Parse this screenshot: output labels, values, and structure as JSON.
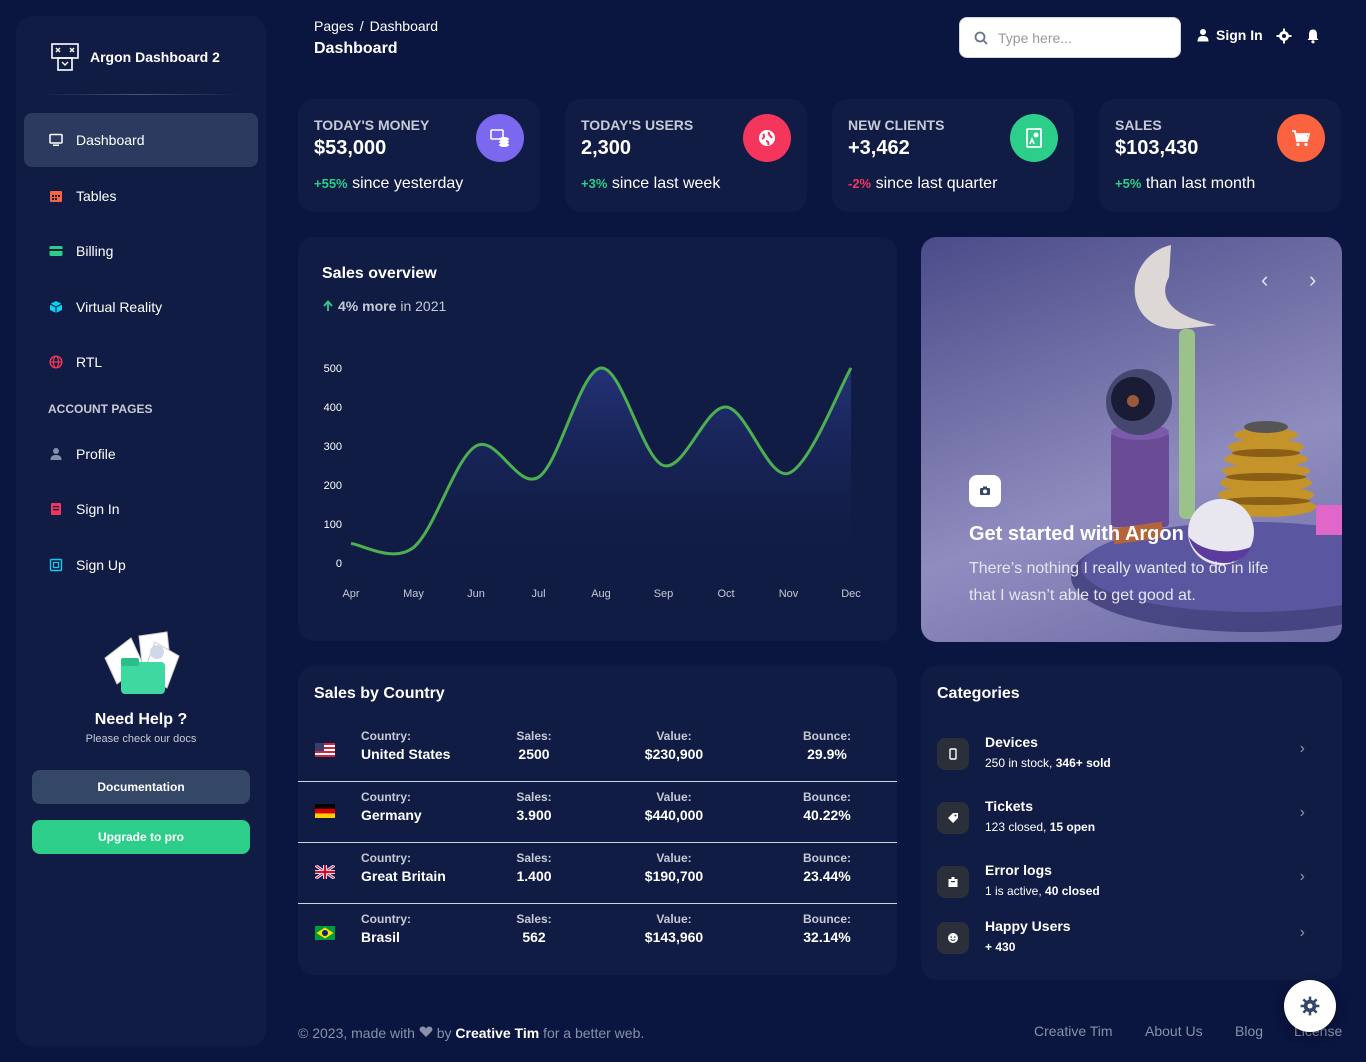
{
  "sidebar": {
    "brand": "Argon Dashboard 2",
    "items": [
      {
        "label": "Dashboard",
        "icon": "tv-icon",
        "color": "#ffffff"
      },
      {
        "label": "Tables",
        "icon": "calendar-icon",
        "color": "#fb6340"
      },
      {
        "label": "Billing",
        "icon": "credit-card-icon",
        "color": "#2dce89"
      },
      {
        "label": "Virtual Reality",
        "icon": "cube-icon",
        "color": "#11cdef"
      },
      {
        "label": "RTL",
        "icon": "world-icon",
        "color": "#f5365c"
      }
    ],
    "section_label": "ACCOUNT PAGES",
    "account_items": [
      {
        "label": "Profile",
        "icon": "user-icon",
        "color": "#8392ab"
      },
      {
        "label": "Sign In",
        "icon": "copy-icon",
        "color": "#f5365c"
      },
      {
        "label": "Sign Up",
        "icon": "collection-icon",
        "color": "#11cdef"
      }
    ],
    "help": {
      "title": "Need Help ?",
      "subtitle": "Please check our docs"
    },
    "doc_button": "Documentation",
    "pro_button": "Upgrade to pro"
  },
  "header": {
    "breadcrumb_root": "Pages",
    "breadcrumb_sep": "/",
    "breadcrumb_current": "Dashboard",
    "title": "Dashboard",
    "search_placeholder": "Type here...",
    "signin": "Sign In"
  },
  "stats": [
    {
      "label": "Today's Money",
      "value": "$53,000",
      "change": "+55%",
      "change_text": " since yesterday",
      "trend": "up",
      "icon": "money-coins-icon",
      "icon_bg": "#7b68ee"
    },
    {
      "label": "Today's Users",
      "value": "2,300",
      "change": "+3%",
      "change_text": " since last week",
      "trend": "up",
      "icon": "world-icon",
      "icon_bg": "#f5365c"
    },
    {
      "label": "New Clients",
      "value": "+3,462",
      "change": "-2%",
      "change_text": " since last quarter",
      "trend": "down",
      "icon": "paper-diploma-icon",
      "icon_bg": "#2dce89"
    },
    {
      "label": "Sales",
      "value": "$103,430",
      "change": "+5%",
      "change_text": " than last month",
      "trend": "up",
      "icon": "cart-icon",
      "icon_bg": "#fb6340"
    }
  ],
  "sales_overview": {
    "title": "Sales overview",
    "highlight": "4% more",
    "suffix": " in 2021"
  },
  "chart_data": {
    "type": "line",
    "categories": [
      "Apr",
      "May",
      "Jun",
      "Jul",
      "Aug",
      "Sep",
      "Oct",
      "Nov",
      "Dec"
    ],
    "series": [
      {
        "values": [
          50,
          40,
          300,
          220,
          500,
          250,
          400,
          230,
          500
        ]
      }
    ],
    "yticks": [
      0,
      100,
      200,
      300,
      400,
      500
    ],
    "ylim": [
      0,
      500
    ],
    "line_color": "#4cb050",
    "grid": false
  },
  "carousel": {
    "title": "Get started with Argon",
    "text": "There’s nothing I really wanted to do in life that I wasn’t able to get good at.",
    "prev": "‹",
    "next": "›"
  },
  "countries": {
    "title": "Sales by Country",
    "headers": {
      "country": "Country:",
      "sales": "Sales:",
      "value": "Value:",
      "bounce": "Bounce:"
    },
    "rows": [
      {
        "country": "United States",
        "sales": "2500",
        "value": "$230,900",
        "bounce": "29.9%",
        "flag": "us-flag"
      },
      {
        "country": "Germany",
        "sales": "3.900",
        "value": "$440,000",
        "bounce": "40.22%",
        "flag": "de-flag"
      },
      {
        "country": "Great Britain",
        "sales": "1.400",
        "value": "$190,700",
        "bounce": "23.44%",
        "flag": "gb-flag"
      },
      {
        "country": "Brasil",
        "sales": "562",
        "value": "$143,960",
        "bounce": "32.14%",
        "flag": "br-flag"
      }
    ]
  },
  "categories": {
    "title": "Categories",
    "items": [
      {
        "name": "Devices",
        "desc": "250 in stock, ",
        "desc_bold": "346+ sold",
        "icon": "mobile-icon"
      },
      {
        "name": "Tickets",
        "desc": "123 closed, ",
        "desc_bold": "15 open",
        "icon": "tag-icon"
      },
      {
        "name": "Error logs",
        "desc": "1 is active, ",
        "desc_bold": "40 closed",
        "icon": "box-icon"
      },
      {
        "name": "Happy Users",
        "desc": "",
        "desc_bold": "+ 430",
        "icon": "smile-icon"
      }
    ]
  },
  "footer": {
    "copy_prefix": "© 2023, made with ",
    "by": " by ",
    "author": "Creative Tim",
    "copy_suffix": " for a better web.",
    "links": [
      "Creative Tim",
      "About Us",
      "Blog",
      "License"
    ]
  }
}
